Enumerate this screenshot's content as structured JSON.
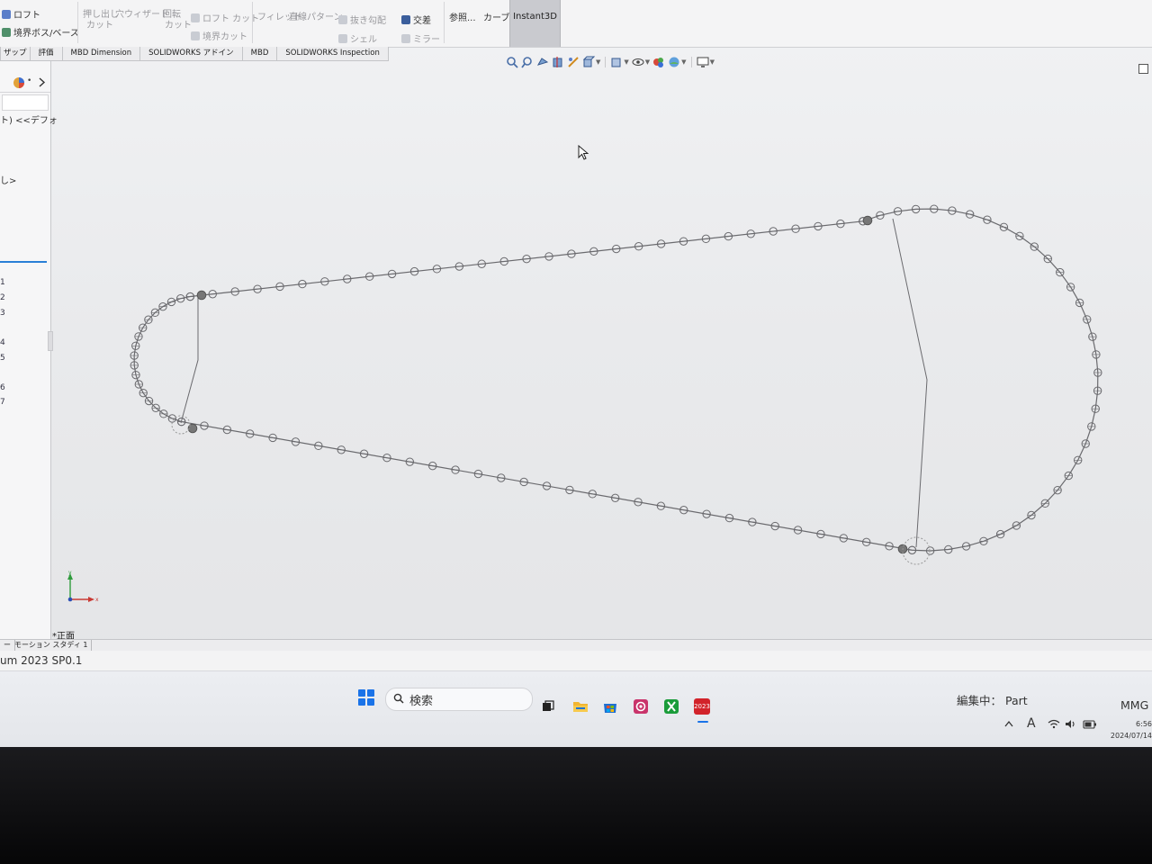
{
  "ribbon": {
    "loft": "ロフト",
    "boundary_boss": "境界ボス/ベース",
    "extrude_cut_line1": "押し出し",
    "extrude_cut_line2": "カット",
    "wizard": "穴ウィザード",
    "revolve_cut_line1": "回転",
    "revolve_cut_line2": "カット",
    "loft_cut": "ロフト カット",
    "boundary_cut": "境界カット",
    "fillet": "フィレット",
    "linear_pattern": "直線パターン",
    "draft": "抜き勾配",
    "intersect": "交差",
    "shell": "シェル",
    "mirror": "ミラー",
    "reference": "参照...",
    "curves": "カーブ",
    "instant3d": "Instant3D",
    "cropped_left": "ザップ"
  },
  "tabs": [
    "評価",
    "MBD Dimension",
    "SOLIDWORKS アドイン",
    "MBD",
    "SOLIDWORKS Inspection"
  ],
  "tree": {
    "row_default": "ト) <<デフォ",
    "row_none": "し>",
    "numbers": [
      "1",
      "2",
      "3",
      "4",
      "5",
      "6",
      "7"
    ]
  },
  "viewport": {
    "view_label": "*正面",
    "triad_x": "x",
    "triad_y": "y"
  },
  "bottom_tabs": [
    "ー",
    "モーション スタディ 1"
  ],
  "status": {
    "version": "um 2023 SP0.1",
    "editing": "編集中： Part",
    "units": "MMG"
  },
  "taskbar": {
    "search_label": "検索",
    "clock_time": "6:56",
    "clock_date": "2024/07/14",
    "ime": "A",
    "sw_badge": "2023"
  },
  "colors": {
    "accent": "#2a7fd6",
    "sketch_line": "#6a6a6e",
    "start_blue": "#1a73e8"
  },
  "icons": [
    "search-icon",
    "wifi-icon",
    "speaker-icon",
    "battery-icon",
    "chevron-up-icon"
  ]
}
